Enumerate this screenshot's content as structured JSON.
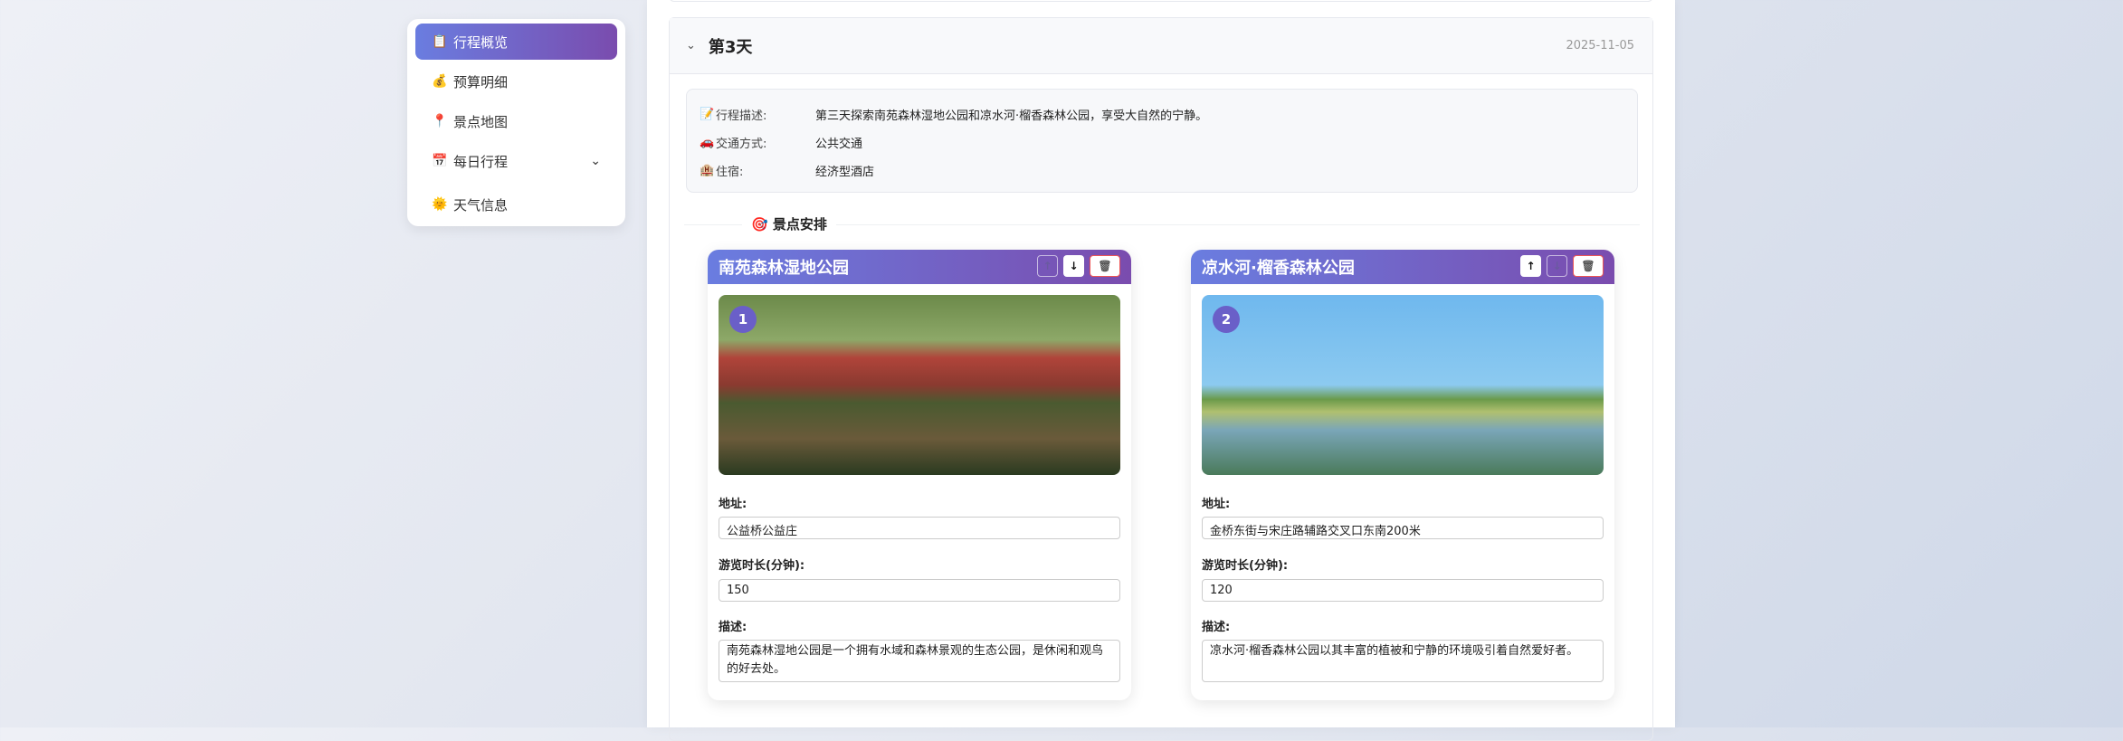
{
  "sidebar": {
    "items": [
      {
        "icon": "clipboard-icon",
        "glyph": "📋",
        "label": "行程概览",
        "active": true
      },
      {
        "icon": "money-bag-icon",
        "glyph": "💰",
        "label": "预算明细"
      },
      {
        "icon": "pin-icon",
        "glyph": "📍",
        "label": "景点地图"
      },
      {
        "icon": "calendar-icon",
        "glyph": "📅",
        "label": "每日行程",
        "chevron": "⌄"
      },
      {
        "icon": "sun-icon",
        "glyph": "🌞",
        "label": "天气信息"
      }
    ]
  },
  "day": {
    "toggle": "⌄",
    "title": "第3天",
    "date": "2025-11-05",
    "info": [
      {
        "glyph": "📝",
        "key": "行程描述:",
        "value": "第三天探索南苑森林湿地公园和凉水河·榴香森林公园，享受大自然的宁静。"
      },
      {
        "glyph": "🚗",
        "key": "交通方式:",
        "value": "公共交通"
      },
      {
        "glyph": "🏨",
        "key": "住宿:",
        "value": "经济型酒店"
      }
    ],
    "section_title": "🎯 景点安排"
  },
  "attractions": [
    {
      "index": "1",
      "name": "南苑森林湿地公园",
      "up": "↑",
      "down": "↓",
      "delete": "🗑",
      "address_label": "地址:",
      "address": "公益桥公益庄",
      "duration_label": "游览时长(分钟):",
      "duration": "150",
      "desc_label": "描述:",
      "desc": "南苑森林湿地公园是一个拥有水域和森林景观的生态公园，是休闲和观鸟的好去处。"
    },
    {
      "index": "2",
      "name": "凉水河·榴香森林公园",
      "up": "↑",
      "down": "↓",
      "delete": "🗑",
      "address_label": "地址:",
      "address": "金桥东街与宋庄路辅路交叉口东南200米",
      "duration_label": "游览时长(分钟):",
      "duration": "120",
      "desc_label": "描述:",
      "desc": "凉水河·榴香森林公园以其丰富的植被和宁静的环境吸引着自然爱好者。"
    }
  ]
}
